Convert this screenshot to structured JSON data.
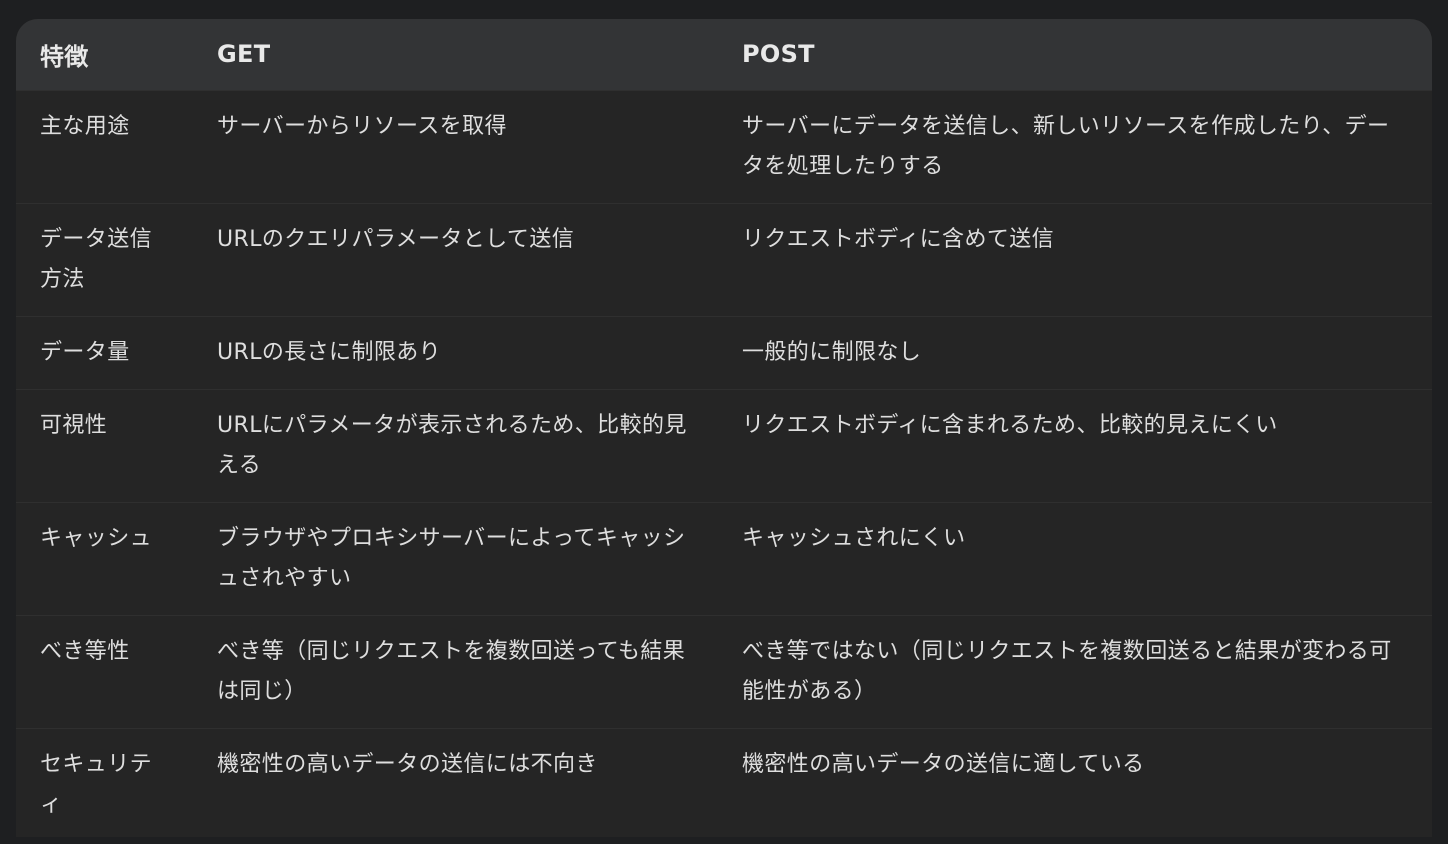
{
  "table": {
    "headers": [
      "特徴",
      "GET",
      "POST"
    ],
    "rows": [
      [
        "主な用途",
        "サーバーからリソースを取得",
        "サーバーにデータを送信し、新しいリソースを作成したり、データを処理したりする"
      ],
      [
        "データ送信方法",
        "URLのクエリパラメータとして送信",
        "リクエストボディに含めて送信"
      ],
      [
        "データ量",
        "URLの長さに制限あり",
        "一般的に制限なし"
      ],
      [
        "可視性",
        "URLにパラメータが表示されるため、比較的見える",
        "リクエストボディに含まれるため、比較的見えにくい"
      ],
      [
        "キャッシュ",
        "ブラウザやプロキシサーバーによってキャッシュされやすい",
        "キャッシュされにくい"
      ],
      [
        "べき等性",
        "べき等（同じリクエストを複数回送っても結果は同じ）",
        "べき等ではない（同じリクエストを複数回送ると結果が変わる可能性がある）"
      ],
      [
        "セキュリティ",
        "機密性の高いデータの送信には不向き",
        "機密性の高いデータの送信に適している"
      ]
    ]
  }
}
